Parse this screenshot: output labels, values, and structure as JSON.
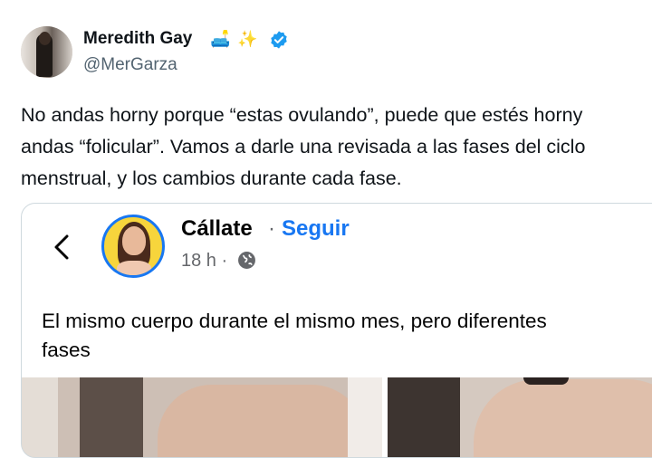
{
  "tweet": {
    "author_name": "Meredith Gay",
    "name_emojis": [
      "🛋️",
      "✨"
    ],
    "verified": true,
    "handle": "@MerGarza",
    "text_lines": [
      "No andas horny porque “estas ovulando”, puede que estés horny",
      "andas “folicular”. Vamos a darle una revisada a las fases del ciclo",
      "menstrual, y los cambios durante cada fase."
    ]
  },
  "embed": {
    "page_name": "Cállate",
    "separator": "·",
    "follow_label": "Seguir",
    "time": "18 h ·",
    "post_text_lines": [
      "El mismo cuerpo durante el mismo mes, pero diferentes",
      "fases"
    ]
  },
  "colors": {
    "verified_blue": "#1d9bf0",
    "facebook_blue": "#1877f2",
    "muted": "#536471"
  },
  "icons": [
    "verified-badge-icon",
    "back-chevron-icon",
    "globe-icon"
  ]
}
